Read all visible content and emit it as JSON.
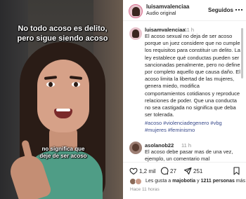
{
  "video": {
    "caption_top": "No todo acoso es delito, pero sigue siendo acoso",
    "caption_bottom": "no significa que deje de ser acoso"
  },
  "header": {
    "username": "luisamvalenciaa",
    "audio": "Audio original",
    "follow_label": "Seguidos",
    "more_icon": "more-horizontal-icon"
  },
  "comments": [
    {
      "username": "luisamvalenciaa",
      "time": "11 h",
      "text": "El acoso sexual no deja de ser acoso porque un juez considere que no cumple los requisitos para constituir un delito. La ley establece qué conductas pueden ser sancionadas penalmente, pero no define por completo aquello que causa daño. El acoso limita la libertad de las mujeres, genera miedo, modifica comportamientos cotidianos y reproduce relaciones de poder. Que una conducta no sea castigada no significa que deba ser tolerada.",
      "tags": "#acoso #violenciadegenero #vbg #mujeres #feminismo"
    },
    {
      "username": "asolanob22",
      "time": "11 h",
      "text": "El acoso debe pasar mas de una vez, ejemplo, un comentario mal"
    }
  ],
  "actions": {
    "likes_count": "1,2 mil",
    "comments_count": "27",
    "shares_count": "251"
  },
  "likes": {
    "prefix": "Les gusta a ",
    "user": "majobotia",
    "suffix": " y ",
    "others": "1211 personas",
    "ending": " más"
  },
  "time_ago": "Hace 11 horas",
  "colors": {
    "hashtag": "#3a4b8c",
    "shirt": "#4f9d86"
  }
}
